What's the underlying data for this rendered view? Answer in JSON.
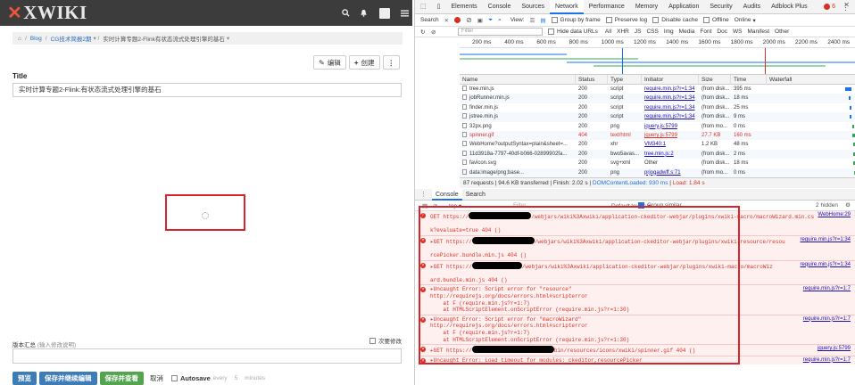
{
  "wiki": {
    "logo": "XWIKI",
    "breadcrumb": [
      "Blog",
      "CG技术简报2期",
      "实时计算专题2-Flink有状态流式处理引擎的基石"
    ],
    "edit_label": "编辑",
    "create_label": "创建",
    "title_label": "Title",
    "title_value": "实时计算专题2-Flink:有状态流式处理引擎的基石",
    "summary_label": "版本汇总",
    "summary_hint": "(输入修改说明)",
    "minor_edit_label": "次要修改",
    "buttons": {
      "preview": "预览",
      "save_continue": "保存并继续编辑",
      "save_view": "保存并查看",
      "cancel": "取消",
      "autosave": "Autosave",
      "autosave_every": "every",
      "autosave_minutes": "5",
      "autosave_unit": "minutes"
    }
  },
  "devtools": {
    "tabs": [
      "Elements",
      "Console",
      "Sources",
      "Network",
      "Performance",
      "Memory",
      "Application",
      "Security",
      "Audits",
      "Adblock Plus"
    ],
    "active_tab": "Network",
    "error_count": "6",
    "toolbar": {
      "search": "Search",
      "view": "View:",
      "group_by_frame": "Group by frame",
      "preserve_log": "Preserve log",
      "disable_cache": "Disable cache",
      "offline": "Offline",
      "throttle": "Online"
    },
    "filter": {
      "placeholder": "Filter",
      "hide_data_urls": "Hide data URLs",
      "types": [
        "All",
        "XHR",
        "JS",
        "CSS",
        "Img",
        "Media",
        "Font",
        "Doc",
        "WS",
        "Manifest",
        "Other"
      ]
    },
    "timeline_ticks": [
      "200 ms",
      "400 ms",
      "600 ms",
      "800 ms",
      "1000 ms",
      "1200 ms",
      "1400 ms",
      "1600 ms",
      "1800 ms",
      "2000 ms",
      "2200 ms",
      "2400 ms"
    ],
    "columns": [
      "Name",
      "Status",
      "Type",
      "Initiator",
      "Size",
      "Time",
      "Waterfall"
    ],
    "requests": [
      {
        "name": "tree.min.js",
        "status": "200",
        "type": "script",
        "initiator": "require.min.js?r=1:34",
        "size": "(from disk...",
        "time": "395 ms",
        "bar": [
          0.88,
          0.07
        ],
        "color": "blue"
      },
      {
        "name": "jobRunner.min.js",
        "status": "200",
        "type": "script",
        "initiator": "require.min.js?r=1:34",
        "size": "(from disk...",
        "time": "18 ms",
        "bar": [
          0.92,
          0.01
        ],
        "color": "blue"
      },
      {
        "name": "finder.min.js",
        "status": "200",
        "type": "script",
        "initiator": "require.min.js?r=1:34",
        "size": "(from disk...",
        "time": "25 ms",
        "bar": [
          0.93,
          0.01
        ],
        "color": "blue"
      },
      {
        "name": "jstree.min.js",
        "status": "200",
        "type": "script",
        "initiator": "require.min.js?r=1:34",
        "size": "(from disk...",
        "time": "9 ms",
        "bar": [
          0.93,
          0.01
        ],
        "color": "blue"
      },
      {
        "name": "32px.png",
        "status": "200",
        "type": "png",
        "initiator": "jquery.js:5799",
        "size": "(from mo...",
        "time": "0 ms",
        "bar": [
          0.96,
          0.01
        ],
        "color": "green"
      },
      {
        "name": "spinner.gif",
        "status": "404",
        "type": "text/html",
        "initiator": "jquery.js:5799",
        "size": "27.7 KB",
        "time": "160 ms",
        "bar": [
          0.96,
          0.03
        ],
        "color": "green",
        "error": true
      },
      {
        "name": "WebHome?outputSyntax=plain&sheet=...",
        "status": "200",
        "type": "xhr",
        "initiator": "VM340:1",
        "size": "1.2 KB",
        "time": "48 ms",
        "bar": [
          0.97,
          0.02
        ],
        "color": "green"
      },
      {
        "name": "11d3918a-7797-40df-b066-02899902fa...",
        "status": "200",
        "type": "bwo5avas...",
        "initiator": "tree.min.js:2",
        "size": "(from disk...",
        "time": "2 ms",
        "bar": [
          0.97,
          0.01
        ],
        "color": "green"
      },
      {
        "name": "favicon.svg",
        "status": "200",
        "type": "svg+xml",
        "initiator": "Other",
        "size": "(from disk...",
        "time": "18 ms",
        "bar": [
          0.97,
          0.01
        ],
        "color": "green",
        "plain_initiator": true
      },
      {
        "name": "data:image/png;base...",
        "status": "200",
        "type": "png",
        "initiator": "prjogadwff.s:71",
        "size": "(from mo...",
        "time": "0 ms",
        "bar": [
          0.98,
          0.01
        ],
        "color": "green"
      }
    ],
    "status_bar": {
      "requests": "87 requests | 94.6 KB transferred | Finish: 2.02 s |",
      "dcl": "DOMContentLoaded: 930 ms",
      "sep": "|",
      "load": "Load: 1.84 s"
    },
    "drawer": {
      "tabs": [
        "Console",
        "Search"
      ],
      "active": "Console",
      "context": "top",
      "filter_placeholder": "Filter",
      "levels": "Default levels ▾",
      "group_similar": "Group similar",
      "hidden": "2 hidden"
    },
    "console_messages": [
      {
        "kind": "circle",
        "lines": [
          "GET https://",
          "/webjars/wiki%3Axwiki/application-ckeditor-webjar/plugins/xwiki-macro/macroWizard.min.cs",
          "k?evaluate=true 404 ()"
        ],
        "redact": 70,
        "source": "WebHome:29"
      },
      {
        "kind": "x",
        "lines": [
          "▸GET https://",
          "/webjars/wiki%3Axwiki/application-ckeditor-webjar/plugins/xwiki-resource/resou",
          "rcePicker.bundle.min.js 404 ()"
        ],
        "redact": 70,
        "source": "require.min.js?r=1:34"
      },
      {
        "kind": "x",
        "lines": [
          "▸GET https://",
          "/webjars/wiki%3Axwiki/application-ckeditor-webjar/plugins/xwiki-macro/macroWiz",
          "ard.bundle.min.js 404 ()"
        ],
        "redact": 56,
        "source": "require.min.js?r=1:34"
      },
      {
        "kind": "x",
        "lines": [
          "▸Uncaught Error: Script error for \"resource\"",
          "http://requirejs.org/docs/errors.html#scripterror",
          "    at F (require.min.js?r=1:7)",
          "    at HTMLScriptElement.onScriptError (require.min.js?r=1:30)"
        ],
        "source": "require.min.js?r=1:7"
      },
      {
        "kind": "x",
        "lines": [
          "▸Uncaught Error: Script error for \"macroWizard\"",
          "http://requirejs.org/docs/errors.html#scripterror",
          "    at F (require.min.js?r=1:7)",
          "    at HTMLScriptElement.onScriptError (require.min.js?r=1:30)"
        ],
        "source": "require.min.js?r=1:7"
      },
      {
        "kind": "x",
        "lines": [
          "▸GET https://",
          "bin/resources/icons/xwiki/spinner.gif 404 ()"
        ],
        "redact": 92,
        "source": "jquery.js:5799"
      },
      {
        "kind": "x",
        "lines": [
          "▸Uncaught Error: Load timeout for modules: ckeditor,resourcePicker",
          "http://requirejs.org/docs/errors.html#timeout",
          "    at F (require.min.js?r=1:7)",
          "    at H (require.min.js?r=1:13)",
          "    at require.min.js?r=1:13"
        ],
        "source": "require.min.js?r=1:7"
      }
    ]
  }
}
